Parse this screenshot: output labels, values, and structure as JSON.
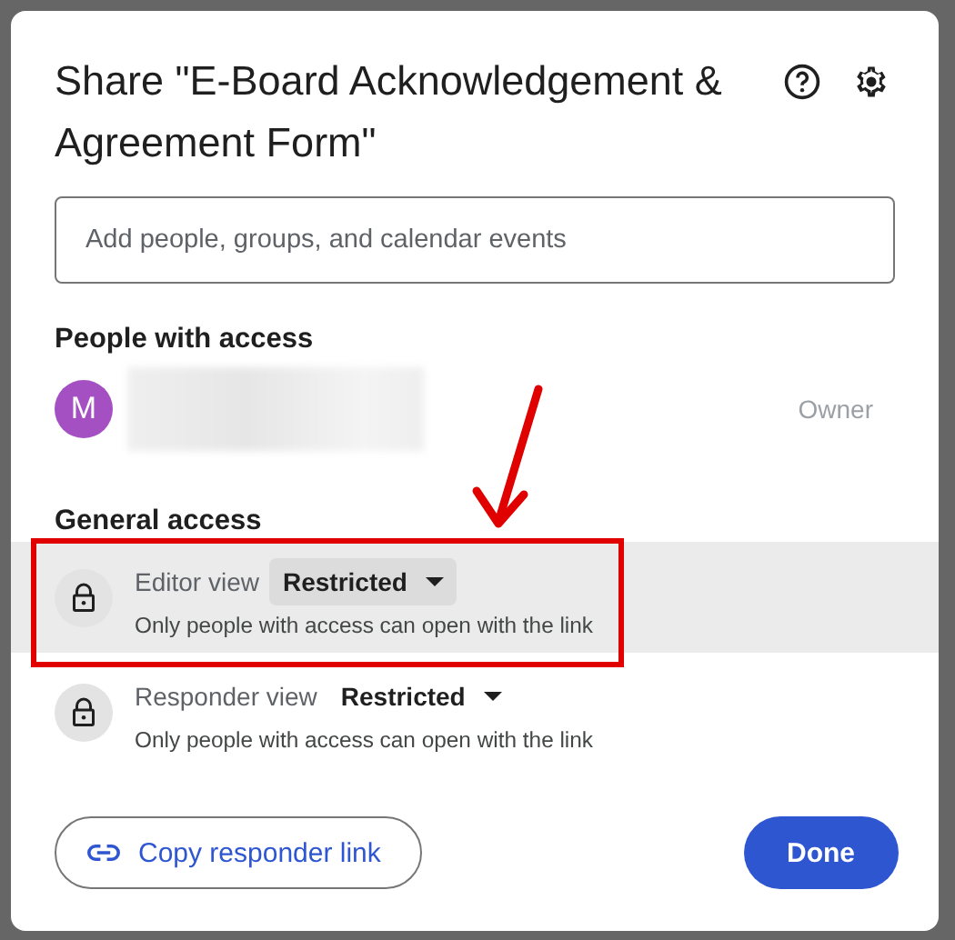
{
  "dialog": {
    "title": "Share \"E-Board Acknowledgement & Agreement Form\"",
    "search": {
      "placeholder": "Add people, groups, and calendar events"
    },
    "people_heading": "People with access",
    "people": [
      {
        "initial": "M",
        "color": "#a450c2",
        "role": "Owner"
      }
    ],
    "general_heading": "General access",
    "access": [
      {
        "label": "Editor view",
        "value": "Restricted",
        "description": "Only people with access can open with the link",
        "selected": true,
        "annotated": true
      },
      {
        "label": "Responder view",
        "value": "Restricted",
        "description": "Only people with access can open with the link",
        "selected": false,
        "annotated": false
      }
    ],
    "copy_link": "Copy responder link",
    "done": "Done"
  }
}
